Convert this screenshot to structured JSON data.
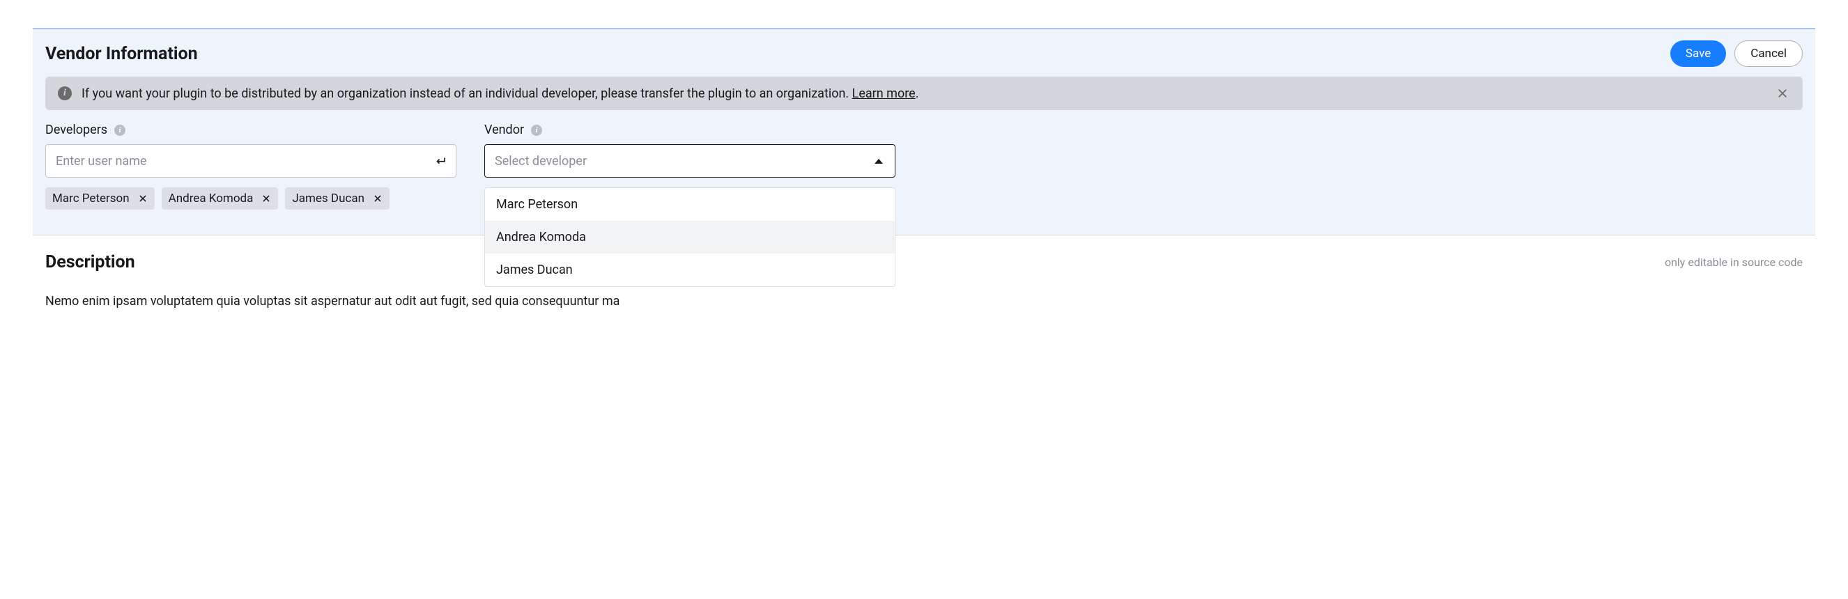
{
  "vendor_section": {
    "title": "Vendor Information",
    "save_label": "Save",
    "cancel_label": "Cancel",
    "alert_text": "If you want your plugin to be distributed by an organization instead of an individual developer, please transfer the plugin to an organization. ",
    "alert_link": "Learn more",
    "alert_period": ".",
    "developers": {
      "label": "Developers",
      "placeholder": "Enter user name",
      "chips": [
        "Marc Peterson",
        "Andrea Komoda",
        "James Ducan"
      ]
    },
    "vendor": {
      "label": "Vendor",
      "placeholder": "Select developer",
      "options": [
        "Marc Peterson",
        "Andrea Komoda",
        "James Ducan"
      ],
      "highlighted_index": 1
    }
  },
  "description_section": {
    "title": "Description",
    "note": "only editable in source code",
    "body": "Nemo enim ipsam voluptatem quia voluptas sit aspernatur aut odit aut fugit, sed quia consequuntur ma"
  }
}
